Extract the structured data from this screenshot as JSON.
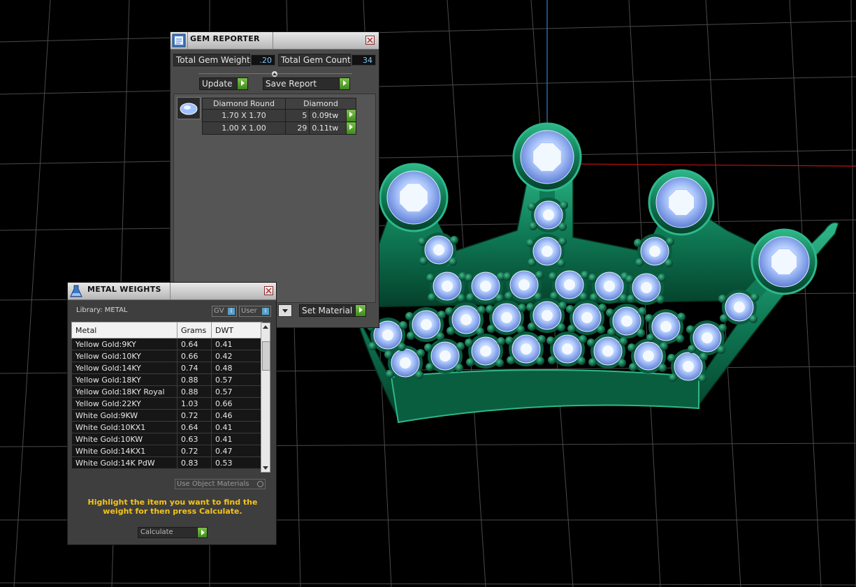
{
  "gem_reporter": {
    "title": "GEM REPORTER",
    "total_weight_label": "Total Gem Weight",
    "total_weight_value": ".20",
    "total_count_label": "Total Gem Count",
    "total_count_value": "34",
    "update_label": "Update",
    "save_label": "Save Report",
    "set_material_label": "Set Material",
    "group": {
      "shape": "Diamond Round",
      "material": "Diamond",
      "rows": [
        {
          "size": "1.70 X 1.70",
          "count": "5",
          "weight": "0.09tw"
        },
        {
          "size": "1.00 X 1.00",
          "count": "29",
          "weight": "0.11tw"
        }
      ]
    }
  },
  "metal_weights": {
    "title": "METAL WEIGHTS",
    "library_label": "Library: METAL",
    "gv_label": "GV",
    "user_label": "User",
    "columns": [
      "Metal",
      "Grams",
      "DWT"
    ],
    "rows": [
      [
        "Yellow Gold:9KY",
        "0.64",
        "0.41"
      ],
      [
        "Yellow Gold:10KY",
        "0.66",
        "0.42"
      ],
      [
        "Yellow Gold:14KY",
        "0.74",
        "0.48"
      ],
      [
        "Yellow Gold:18KY",
        "0.88",
        "0.57"
      ],
      [
        "Yellow Gold:18KY Royal",
        "0.88",
        "0.57"
      ],
      [
        "Yellow Gold:22KY",
        "1.03",
        "0.66"
      ],
      [
        "White Gold:9KW",
        "0.72",
        "0.46"
      ],
      [
        "White Gold:10KX1",
        "0.64",
        "0.41"
      ],
      [
        "White Gold:10KW",
        "0.63",
        "0.41"
      ],
      [
        "White Gold:14KX1",
        "0.72",
        "0.47"
      ],
      [
        "White Gold:14K PdW",
        "0.83",
        "0.53"
      ]
    ],
    "use_object_materials": "Use Object Materials",
    "hint": "Highlight the item you want to find the weight for then press Calculate.",
    "calculate_label": "Calculate"
  },
  "colors": {
    "crown_metal": "#0f7a55",
    "gem": "#9ec0ff",
    "grid": "#4a4a4a",
    "axis_x": "#c01010",
    "axis_y": "#2c80c8",
    "hint_text": "#f5c518"
  }
}
